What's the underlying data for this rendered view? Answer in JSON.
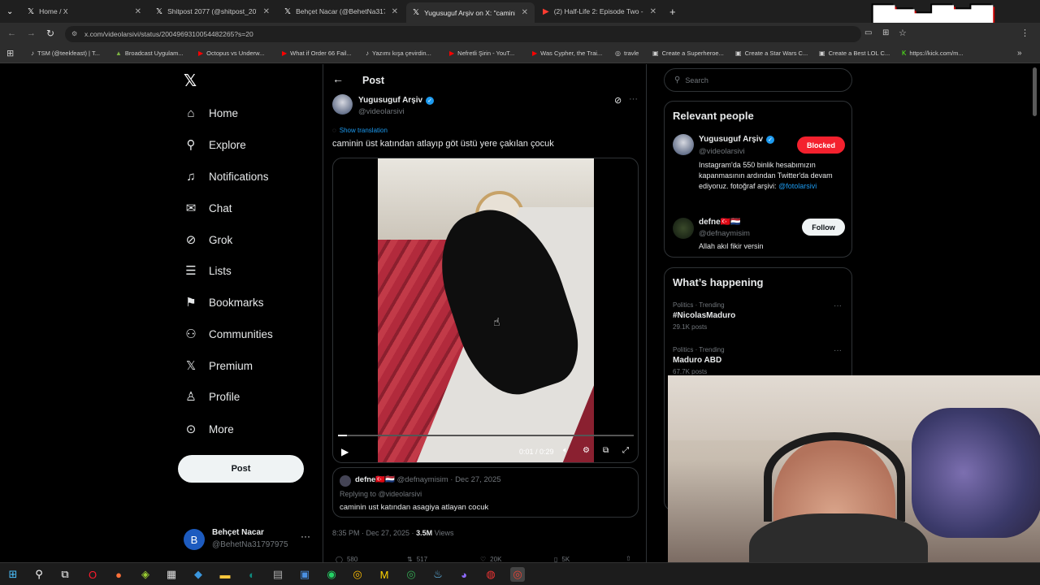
{
  "browser": {
    "tabs": [
      {
        "title": "Home / X",
        "icon": "x-logo-icon"
      },
      {
        "title": "Shitpost 2077 (@shitpost_2077)",
        "icon": "x-logo-icon"
      },
      {
        "title": "Behçet Nacar (@BehetNa31797",
        "icon": "x-logo-icon"
      },
      {
        "title": "Yugusuguf Arşiv on X: \"caminin",
        "icon": "x-logo-icon"
      },
      {
        "title": "(2) Half-Life 2: Episode Two - A",
        "icon": "youtube-icon"
      }
    ],
    "url": "x.com/videolarsivi/status/2004969310054482265?s=20",
    "bookmarks": [
      "TSM (@teekfeast) | T...",
      "Broadcast Uygulam...",
      "Octopus vs Underw...",
      "What if Order 66 Fail...",
      "Yazımı kışa çevirdin...",
      "Nefretli Şirin - YouT...",
      "Was Cypher, the Trai...",
      "travle",
      "Create a Superheroe...",
      "Create a Star Wars C...",
      "Create a Best LOL C...",
      "https://kick.com/m..."
    ]
  },
  "nav": {
    "items": [
      {
        "label": "Home",
        "icon": "home-icon"
      },
      {
        "label": "Explore",
        "icon": "search-icon"
      },
      {
        "label": "Notifications",
        "icon": "bell-icon"
      },
      {
        "label": "Chat",
        "icon": "mail-icon"
      },
      {
        "label": "Grok",
        "icon": "grok-icon"
      },
      {
        "label": "Lists",
        "icon": "list-icon"
      },
      {
        "label": "Bookmarks",
        "icon": "bookmark-icon"
      },
      {
        "label": "Communities",
        "icon": "communities-icon"
      },
      {
        "label": "Premium",
        "icon": "x-logo-icon"
      },
      {
        "label": "Profile",
        "icon": "person-icon"
      },
      {
        "label": "More",
        "icon": "more-icon"
      }
    ],
    "post_label": "Post",
    "account": {
      "name": "Behçet Nacar",
      "handle": "@BehetNa31797975",
      "initial": "B"
    }
  },
  "post": {
    "header": "Post",
    "author": {
      "name": "Yugusuguf Arşiv",
      "handle": "@videolarsivi"
    },
    "show_translation": "Show translation",
    "text": "caminin üst katından atlayıp göt üstü yere çakılan çocuk",
    "video": {
      "time": "0:01 / 0:29",
      "progress": 0.03
    },
    "quoted_reply": {
      "name": "defne🇹🇷🇳🇱",
      "handle": "@defnaymisim",
      "date": "Dec 27, 2025",
      "replying_to": "Replying to @videolarsivi",
      "text": "caminin ust katından asagiya atlayan cocuk"
    },
    "meta": {
      "time": "8:35 PM · Dec 27, 2025 ·",
      "views_count": "3.5M",
      "views_label": "Views"
    },
    "stats": {
      "replies": "580",
      "reposts": "517",
      "likes": "20K",
      "bookmarks": "5K"
    }
  },
  "sidebar": {
    "search_placeholder": "Search",
    "relevant_title": "Relevant people",
    "people": [
      {
        "name": "Yugusuguf Arşiv",
        "handle": "@videolarsivi",
        "button": "Blocked",
        "bio": "Instagram'da 550 binlik hesabımızın kapanmasının ardından Twitter'da devam ediyoruz. fotoğraf arşivi:",
        "bio_link": "@fotolarsivi"
      },
      {
        "name": "defne🇹🇷🇳🇱",
        "handle": "@defnaymisim",
        "button": "Follow",
        "bio": "Allah akıl fikir versin"
      }
    ],
    "happening_title": "What’s happening",
    "trends": [
      {
        "context": "Politics · Trending",
        "name": "#NicolasMaduro",
        "posts": "29.1K posts"
      },
      {
        "context": "Politics · Trending",
        "name": "Maduro ABD",
        "posts": "67.7K posts"
      }
    ]
  },
  "colors": {
    "accent": "#1d9bf0",
    "blocked": "#f4212e",
    "background": "#000000"
  }
}
